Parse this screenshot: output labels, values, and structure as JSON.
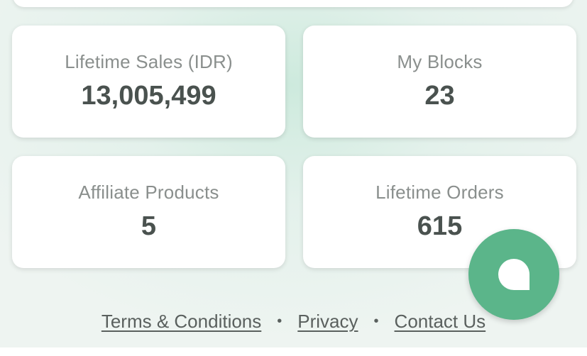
{
  "stats": [
    {
      "label": "Lifetime Sales (IDR)",
      "value": "13,005,499"
    },
    {
      "label": "My Blocks",
      "value": "23"
    },
    {
      "label": "Affiliate Products",
      "value": "5"
    },
    {
      "label": "Lifetime Orders",
      "value": "615"
    }
  ],
  "footer": {
    "terms": "Terms & Conditions",
    "privacy": "Privacy",
    "contact": "Contact Us",
    "separator": "•"
  },
  "chat_button": {
    "icon": "chat-bubble-icon",
    "color": "#5bb58a"
  }
}
